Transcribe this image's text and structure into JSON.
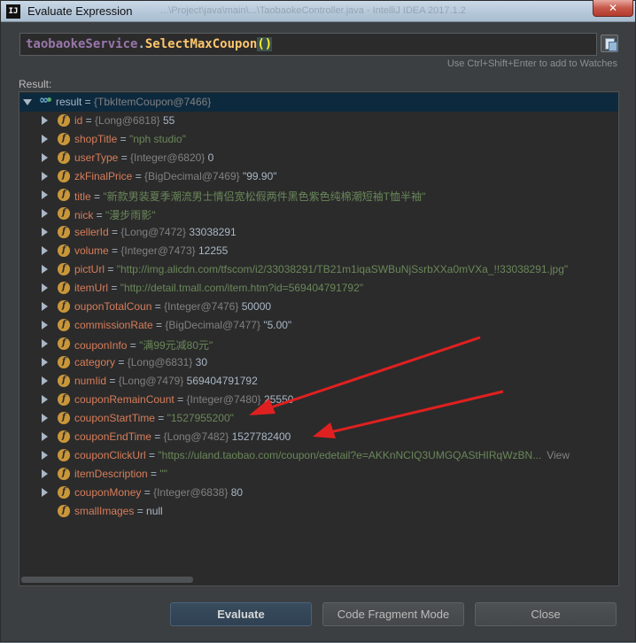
{
  "window": {
    "title": "Evaluate Expression",
    "title_ghost": "...\\Project\\java\\main\\...\\TaobaokeController.java - IntelliJ IDEA 2017.1.2",
    "close_glyph": "✕",
    "app_icon_text": "IJ"
  },
  "expression": {
    "object": "taobaokeService",
    "dot": ".",
    "method": "SelectMaxCoupon",
    "parens": "()",
    "hint": "Use Ctrl+Shift+Enter to add to Watches"
  },
  "result_label": "Result:",
  "root": {
    "name": "result",
    "eq": " = ",
    "ref": "{TbkItemCoupon@7466}"
  },
  "fields": [
    {
      "name": "id",
      "ref": "{Long@6818}",
      "value": "55",
      "kind": "num",
      "expandable": true
    },
    {
      "name": "shopTitle",
      "ref": "",
      "value": "\"nph studio\"",
      "kind": "str",
      "expandable": true
    },
    {
      "name": "userType",
      "ref": "{Integer@6820}",
      "value": "0",
      "kind": "num",
      "expandable": true
    },
    {
      "name": "zkFinalPrice",
      "ref": "{BigDecimal@7469}",
      "value": "\"99.90\"",
      "kind": "num",
      "expandable": true
    },
    {
      "name": "title",
      "ref": "",
      "value": "\"新款男装夏季潮流男士情侣宽松假两件黑色紫色纯棉潮短袖T恤半袖\"",
      "kind": "str",
      "expandable": true
    },
    {
      "name": "nick",
      "ref": "",
      "value": "\"漫步雨影\"",
      "kind": "str",
      "expandable": true
    },
    {
      "name": "sellerId",
      "ref": "{Long@7472}",
      "value": "33038291",
      "kind": "num",
      "expandable": true
    },
    {
      "name": "volume",
      "ref": "{Integer@7473}",
      "value": "12255",
      "kind": "num",
      "expandable": true
    },
    {
      "name": "pictUrl",
      "ref": "",
      "value": "\"http://img.alicdn.com/tfscom/i2/33038291/TB21m1iqaSWBuNjSsrbXXa0mVXa_!!33038291.jpg\"",
      "kind": "str",
      "expandable": true
    },
    {
      "name": "itemUrl",
      "ref": "",
      "value": "\"http://detail.tmall.com/item.htm?id=569404791792\"",
      "kind": "str",
      "expandable": true
    },
    {
      "name": "ouponTotalCoun",
      "ref": "{Integer@7476}",
      "value": "50000",
      "kind": "num",
      "expandable": true
    },
    {
      "name": "commissionRate",
      "ref": "{BigDecimal@7477}",
      "value": "\"5.00\"",
      "kind": "num",
      "expandable": true
    },
    {
      "name": "couponInfo",
      "ref": "",
      "value": "\"满99元减80元\"",
      "kind": "str",
      "expandable": true
    },
    {
      "name": "category",
      "ref": "{Long@6831}",
      "value": "30",
      "kind": "num",
      "expandable": true
    },
    {
      "name": "numIid",
      "ref": "{Long@7479}",
      "value": "569404791792",
      "kind": "num",
      "expandable": true
    },
    {
      "name": "couponRemainCount",
      "ref": "{Integer@7480}",
      "value": "25550",
      "kind": "num",
      "expandable": true
    },
    {
      "name": "couponStartTime",
      "ref": "",
      "value": "\"1527955200\"",
      "kind": "str",
      "expandable": true
    },
    {
      "name": "couponEndTime",
      "ref": "{Long@7482}",
      "value": "1527782400",
      "kind": "num",
      "expandable": true
    },
    {
      "name": "couponClickUrl",
      "ref": "",
      "value": "\"https://uland.taobao.com/coupon/edetail?e=AKKnNCIQ3UMGQAStHIRqWzBN...",
      "kind": "str",
      "expandable": true,
      "link": "View"
    },
    {
      "name": "itemDescription",
      "ref": "",
      "value": "\"\"",
      "kind": "str",
      "expandable": true
    },
    {
      "name": "couponMoney",
      "ref": "{Integer@6838}",
      "value": "80",
      "kind": "num",
      "expandable": true
    },
    {
      "name": "smallImages",
      "ref": "",
      "value": "null",
      "kind": "num",
      "expandable": false
    }
  ],
  "buttons": {
    "evaluate": "Evaluate",
    "code_fragment": "Code Fragment Mode",
    "close": "Close"
  },
  "colors": {
    "annotation_arrow": "#e02020",
    "field_name": "#d77d5b",
    "string_value": "#6a8759"
  }
}
